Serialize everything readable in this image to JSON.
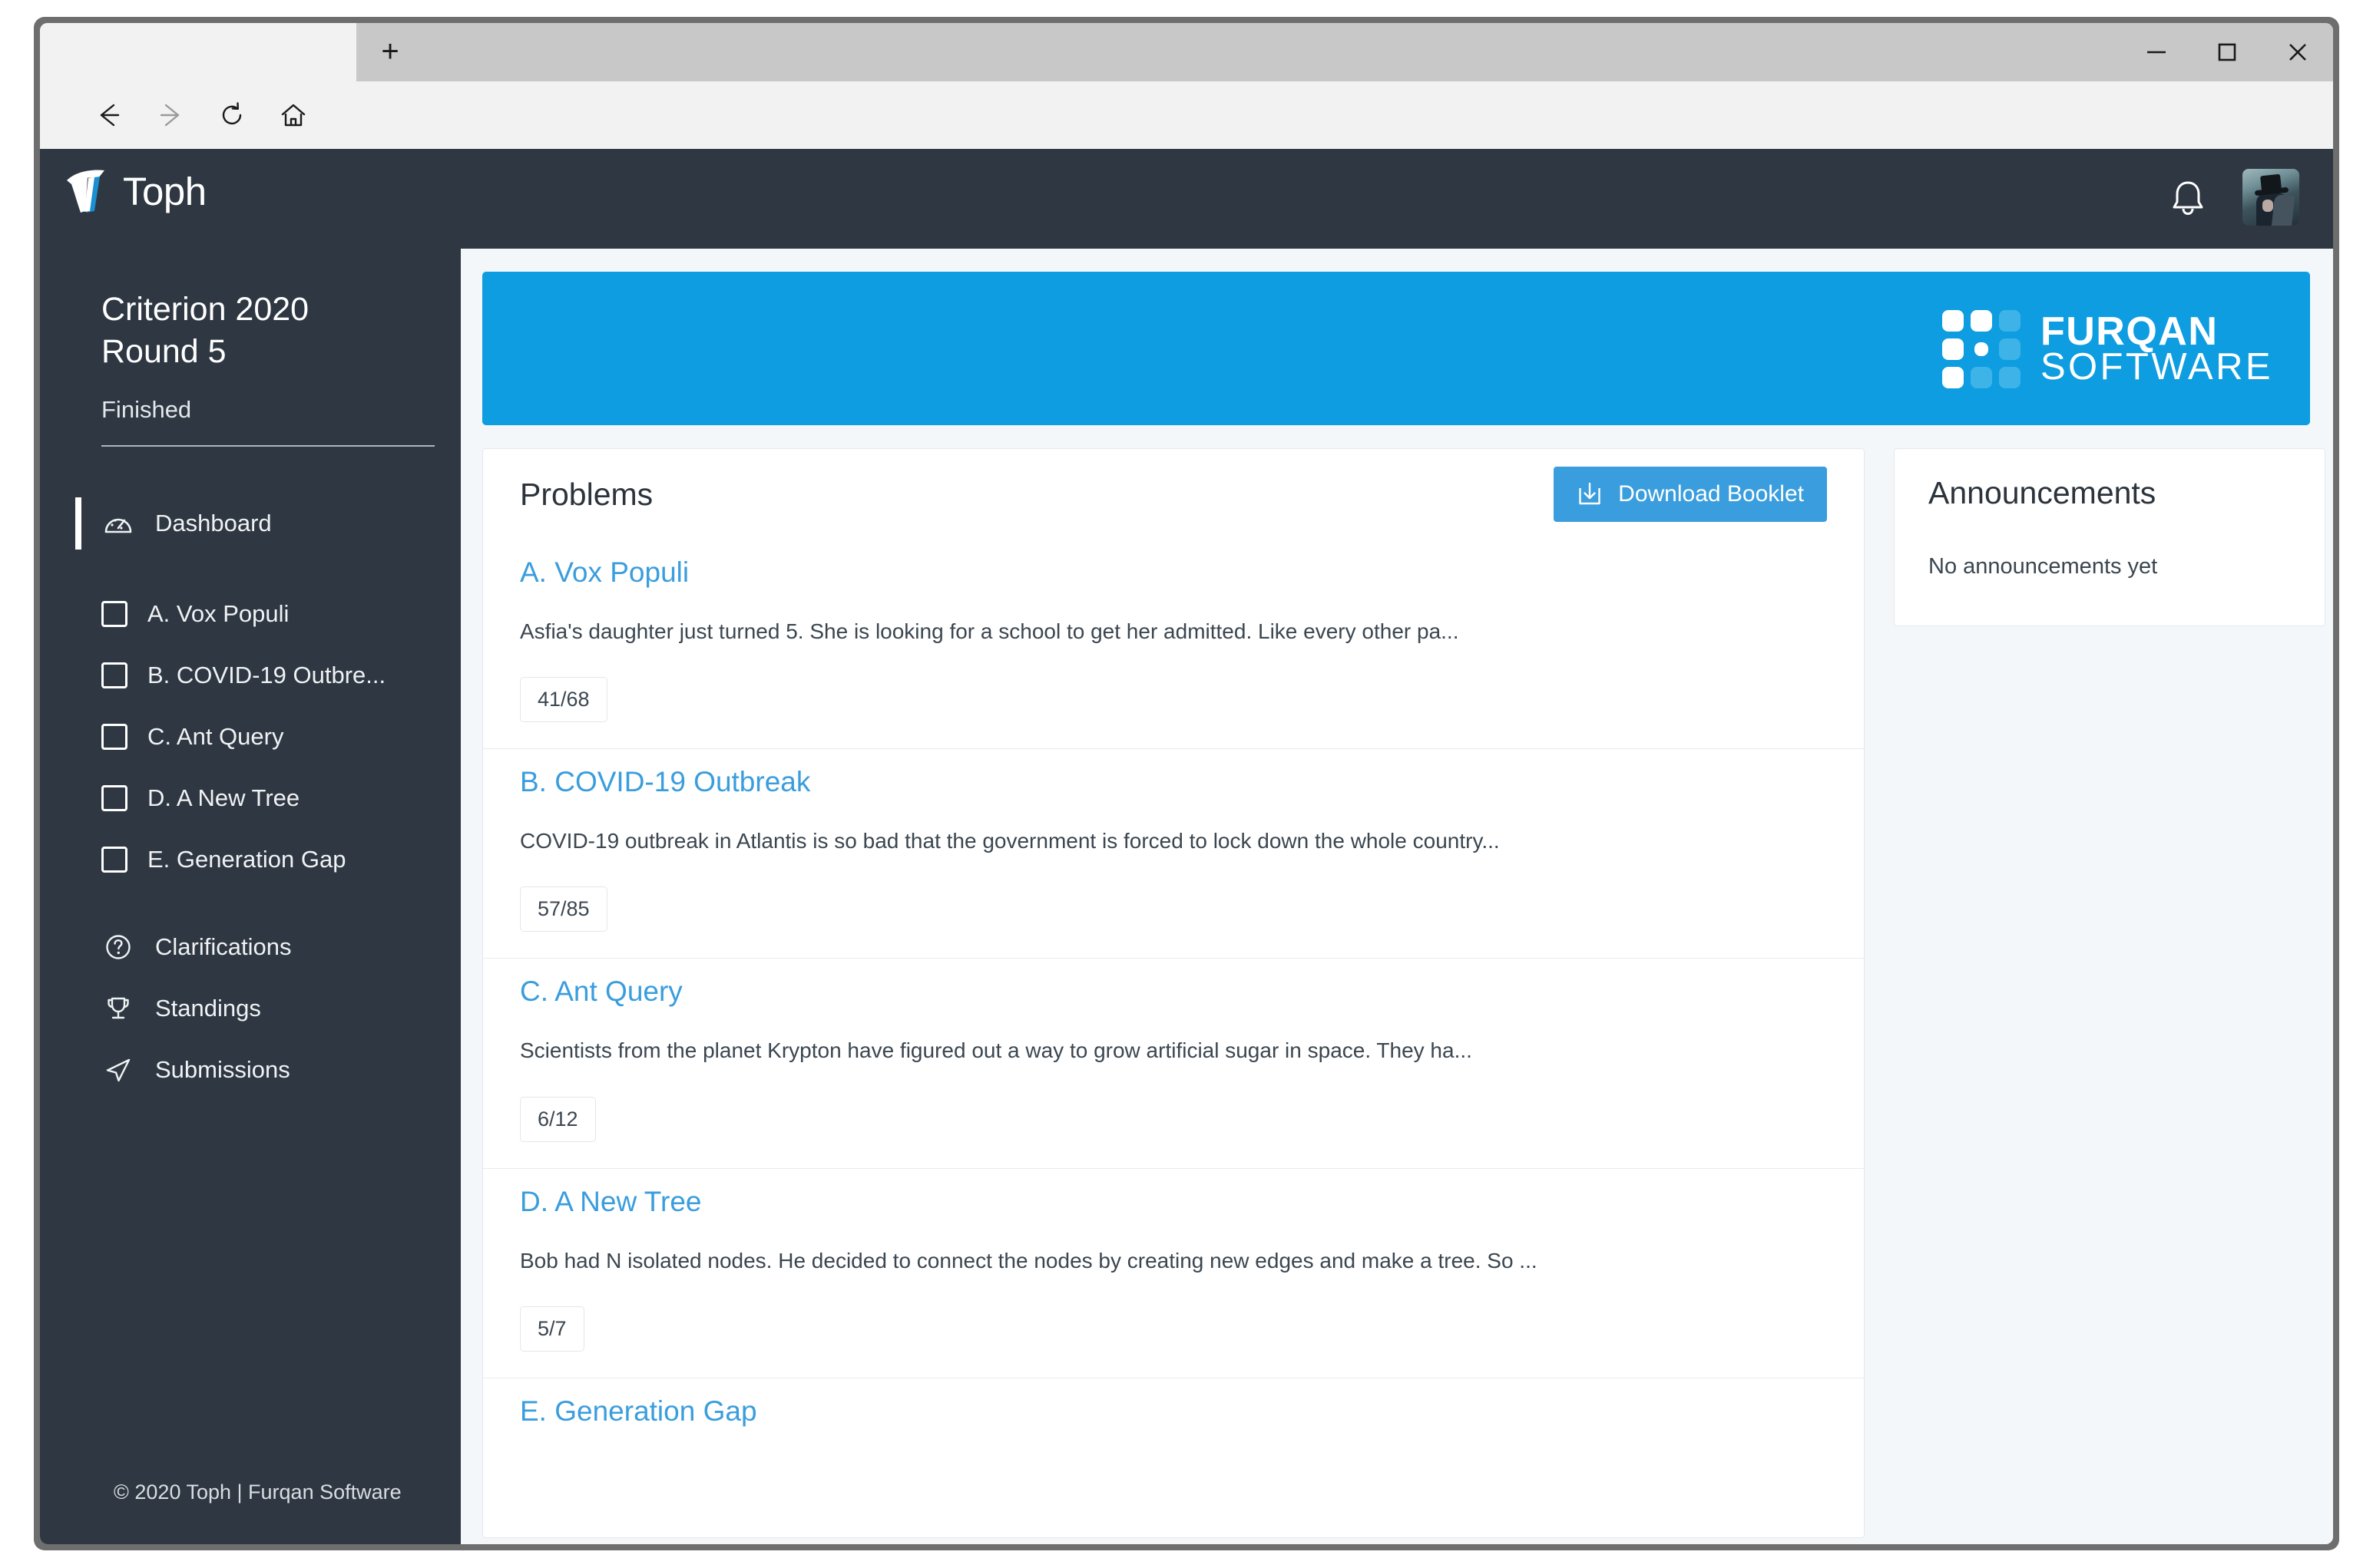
{
  "browser": {
    "new_tab_label": "+",
    "nav": {
      "back": "back-arrow",
      "forward": "forward-arrow",
      "reload": "reload-arrow",
      "home": "home"
    },
    "address_value": "",
    "address_placeholder": "",
    "more_label": "...",
    "window_controls": {
      "minimize": "minimize",
      "maximize": "maximize",
      "close": "close"
    }
  },
  "topbar": {
    "brand": "Toph",
    "bell_icon": "bell-icon",
    "avatar_alt": "user-avatar"
  },
  "sidebar": {
    "contest_title": "Criterion 2020 Round 5",
    "contest_status": "Finished",
    "dashboard": {
      "label": "Dashboard",
      "icon": "speedometer-icon"
    },
    "problems": [
      {
        "label": "A. Vox Populi"
      },
      {
        "label": "B. COVID-19 Outbre..."
      },
      {
        "label": "C. Ant Query"
      },
      {
        "label": "D. A New Tree"
      },
      {
        "label": "E. Generation Gap"
      }
    ],
    "links": [
      {
        "label": "Clarifications",
        "icon": "question-circle-icon"
      },
      {
        "label": "Standings",
        "icon": "trophy-icon"
      },
      {
        "label": "Submissions",
        "icon": "paper-plane-icon"
      }
    ],
    "footer": "© 2020 Toph | Furqan Software"
  },
  "banner": {
    "logo_top": "FURQAN",
    "logo_bottom": "SOFTWARE",
    "background_color": "#0d9de0"
  },
  "problems_panel": {
    "title": "Problems",
    "download_label": "Download Booklet",
    "download_icon": "download-icon",
    "accent_color": "#3a9ddd",
    "items": [
      {
        "title": "A. Vox Populi",
        "description": "Asfia's daughter just turned 5. She is looking for a school to get her admitted. Like every other pa...",
        "stat": "41/68"
      },
      {
        "title": "B. COVID-19 Outbreak",
        "description": "COVID-19 outbreak in Atlantis is so bad that the government is forced to lock down the whole country...",
        "stat": "57/85"
      },
      {
        "title": "C. Ant Query",
        "description": "Scientists from the planet Krypton have figured out a way to grow artificial sugar in space. They ha...",
        "stat": "6/12"
      },
      {
        "title": "D. A New Tree",
        "description": "Bob had N isolated nodes. He decided to connect the nodes by creating new edges and make a tree. So ...",
        "stat": "5/7"
      },
      {
        "title": "E. Generation Gap",
        "description": "",
        "stat": ""
      }
    ]
  },
  "announcements": {
    "title": "Announcements",
    "empty_text": "No announcements yet"
  }
}
